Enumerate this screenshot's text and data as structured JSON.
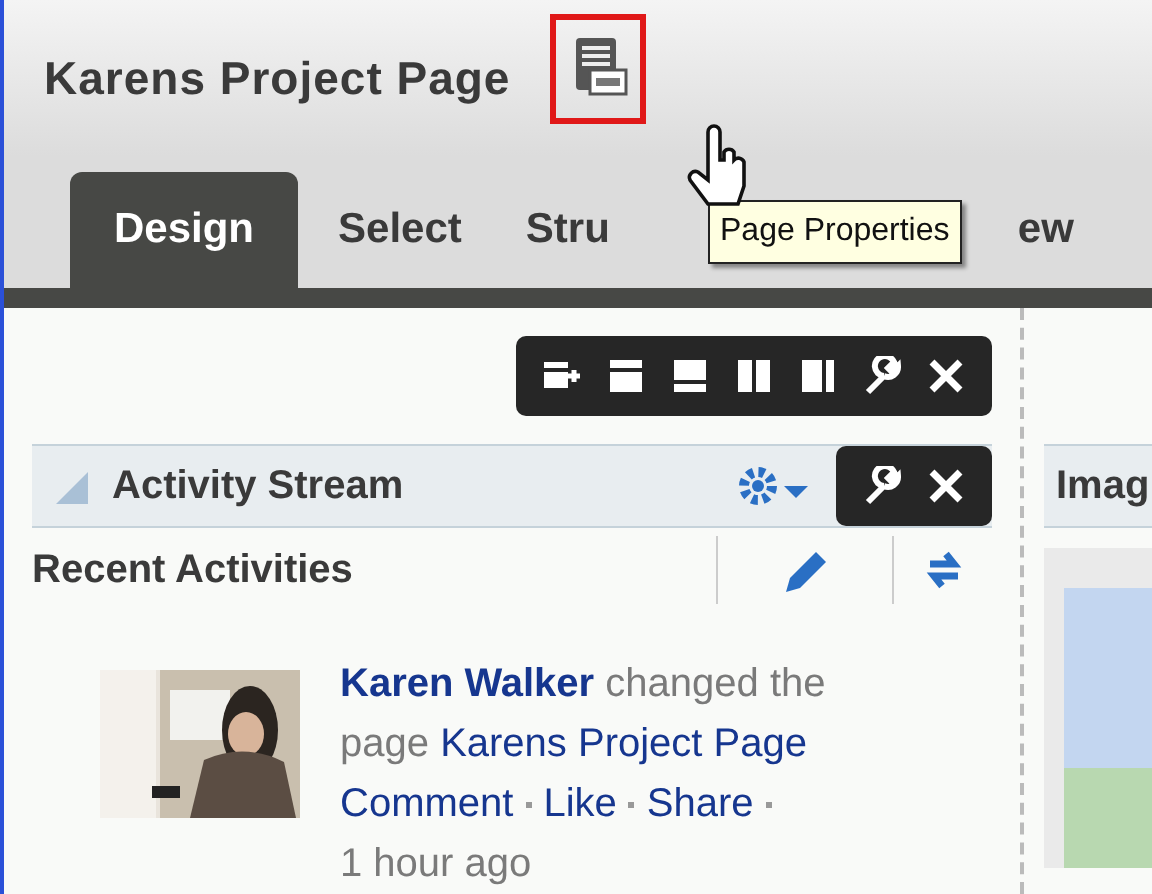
{
  "page": {
    "title": "Karens Project Page"
  },
  "tabs": [
    {
      "label": "Design",
      "selected": true
    },
    {
      "label": "Select",
      "selected": false
    },
    {
      "label": "Stru",
      "selected": false
    },
    {
      "label": "ew",
      "selected": false
    }
  ],
  "tooltip": {
    "text": "Page Properties"
  },
  "task_flow": {
    "title": "Activity Stream",
    "subtitle": "Recent Activities"
  },
  "activity": {
    "author": "Karen Walker",
    "action": "changed the page",
    "target": "Karens Project Page",
    "links": [
      "Comment",
      "Like",
      "Share"
    ],
    "time": "1 hour ago"
  },
  "side_panel": {
    "title": "Imag"
  }
}
